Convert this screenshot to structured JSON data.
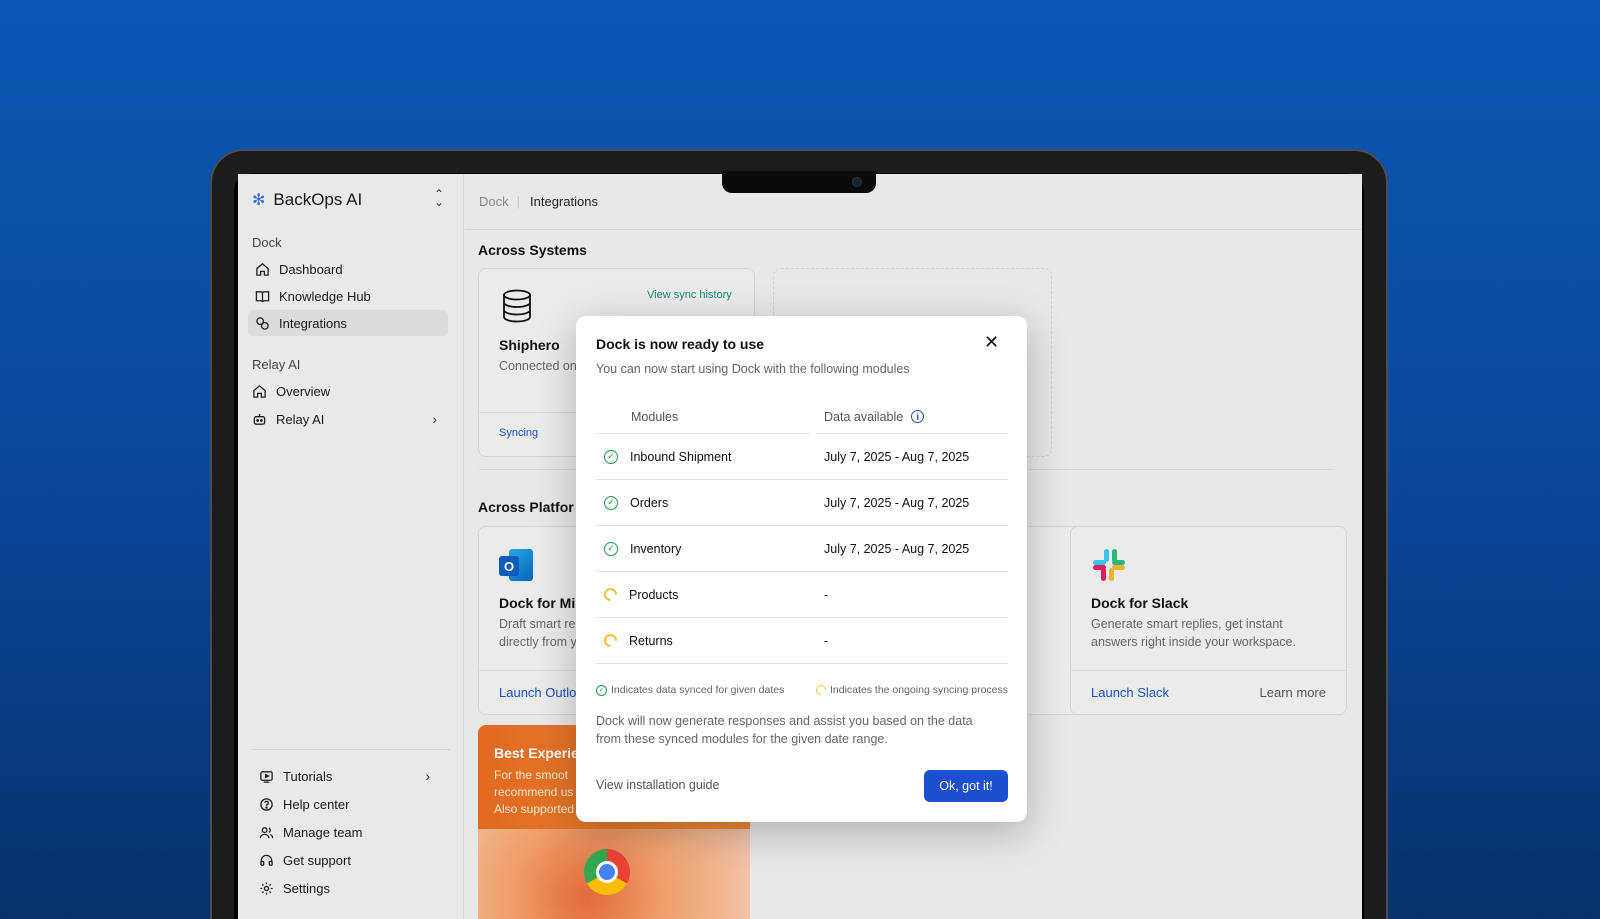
{
  "sidebar": {
    "brand": "BackOps AI",
    "dock_label": "Dock",
    "dock_items": [
      {
        "label": "Dashboard"
      },
      {
        "label": "Knowledge Hub"
      },
      {
        "label": "Integrations"
      }
    ],
    "relay_label": "Relay AI",
    "relay_items": [
      {
        "label": "Overview"
      },
      {
        "label": "Relay AI"
      }
    ],
    "bottom_items": [
      {
        "label": "Tutorials"
      },
      {
        "label": "Help center"
      },
      {
        "label": "Manage team"
      },
      {
        "label": "Get support"
      },
      {
        "label": "Settings"
      }
    ]
  },
  "breadcrumb": {
    "parent": "Dock",
    "current": "Integrations"
  },
  "systems": {
    "title": "Across Systems",
    "shiphero": {
      "name": "Shiphero",
      "status": "Connected on",
      "sync_history": "View sync history",
      "syncing": "Syncing"
    }
  },
  "platforms": {
    "title": "Across Platfor",
    "outlook": {
      "name": "Dock for Mi",
      "desc_line1": "Draft smart re",
      "desc_line2": "directly from y",
      "launch": "Launch Outlo"
    },
    "slack": {
      "name": "Dock for Slack",
      "desc": "Generate smart replies, get instant answers right inside your workspace.",
      "launch": "Launch Slack",
      "learn": "Learn more"
    }
  },
  "promo": {
    "title": "Best Experie",
    "line1": "For the smoot",
    "line2": "recommend us",
    "line3": "Also supported on Firefox."
  },
  "modal": {
    "title": "Dock is now ready to use",
    "close": "✕",
    "subtitle": "You can now start using Dock with the following modules",
    "col_modules": "Modules",
    "col_data": "Data available",
    "rows": [
      {
        "module": "Inbound Shipment",
        "range": "July 7, 2025 - Aug 7, 2025",
        "status": "synced"
      },
      {
        "module": "Orders",
        "range": "July 7, 2025 - Aug 7, 2025",
        "status": "synced"
      },
      {
        "module": "Inventory",
        "range": "July 7, 2025 - Aug 7, 2025",
        "status": "synced"
      },
      {
        "module": "Products",
        "range": "-",
        "status": "syncing"
      },
      {
        "module": "Returns",
        "range": "-",
        "status": "syncing"
      }
    ],
    "legend_synced": "Indicates data synced for given dates",
    "legend_syncing": "Indicates the ongoing syncing process",
    "body": "Dock will now generate responses and assist you based on the data from these synced modules for the given date range.",
    "guide": "View installation guide",
    "ok": "Ok, got it!"
  },
  "colors": {
    "accent": "#1d4fd1",
    "synced": "#1f9a4a",
    "syncing": "#f1c232"
  }
}
